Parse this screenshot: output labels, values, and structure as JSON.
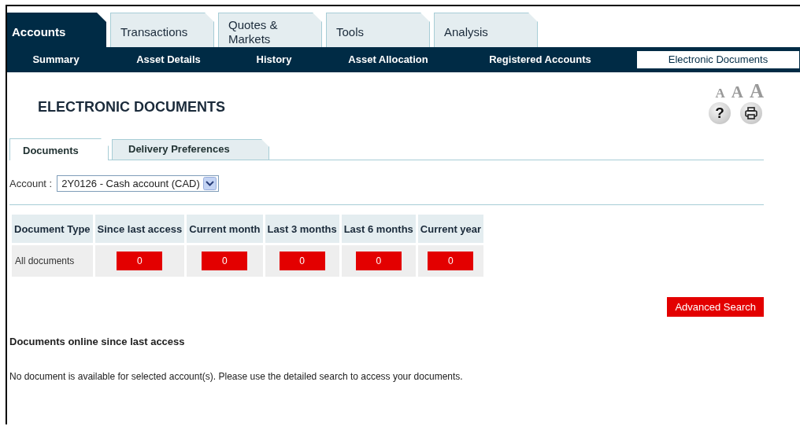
{
  "main_tabs": [
    {
      "label": "Accounts",
      "selected": true
    },
    {
      "label": "Transactions",
      "selected": false
    },
    {
      "label": "Quotes & Markets",
      "selected": false
    },
    {
      "label": "Tools",
      "selected": false
    },
    {
      "label": "Analysis",
      "selected": false
    }
  ],
  "sub_nav": [
    {
      "label": "Summary",
      "selected": false
    },
    {
      "label": "Asset Details",
      "selected": false
    },
    {
      "label": "History",
      "selected": false
    },
    {
      "label": "Asset Allocation",
      "selected": false
    },
    {
      "label": "Registered Accounts",
      "selected": false
    },
    {
      "label": "Electronic Documents",
      "selected": true
    }
  ],
  "page_title": "ELECTRONIC DOCUMENTS",
  "font_sizes": [
    "A",
    "A",
    "A"
  ],
  "help_icon": "?",
  "doc_tabs": [
    {
      "label": "Documents",
      "selected": true
    },
    {
      "label": "Delivery Preferences",
      "selected": false
    }
  ],
  "account": {
    "label": "Account :",
    "value": "2Y0126 - Cash account (CAD)"
  },
  "table": {
    "columns": [
      "Document Type",
      "Since last access",
      "Current month",
      "Last 3 months",
      "Last 6 months",
      "Current year"
    ],
    "rows": [
      {
        "type": "All documents",
        "counts": [
          "0",
          "0",
          "0",
          "0",
          "0"
        ]
      }
    ]
  },
  "advanced_search": "Advanced Search",
  "section_title": "Documents online since last access",
  "message": "No document is available for selected account(s). Please use the detailed search to access your documents."
}
